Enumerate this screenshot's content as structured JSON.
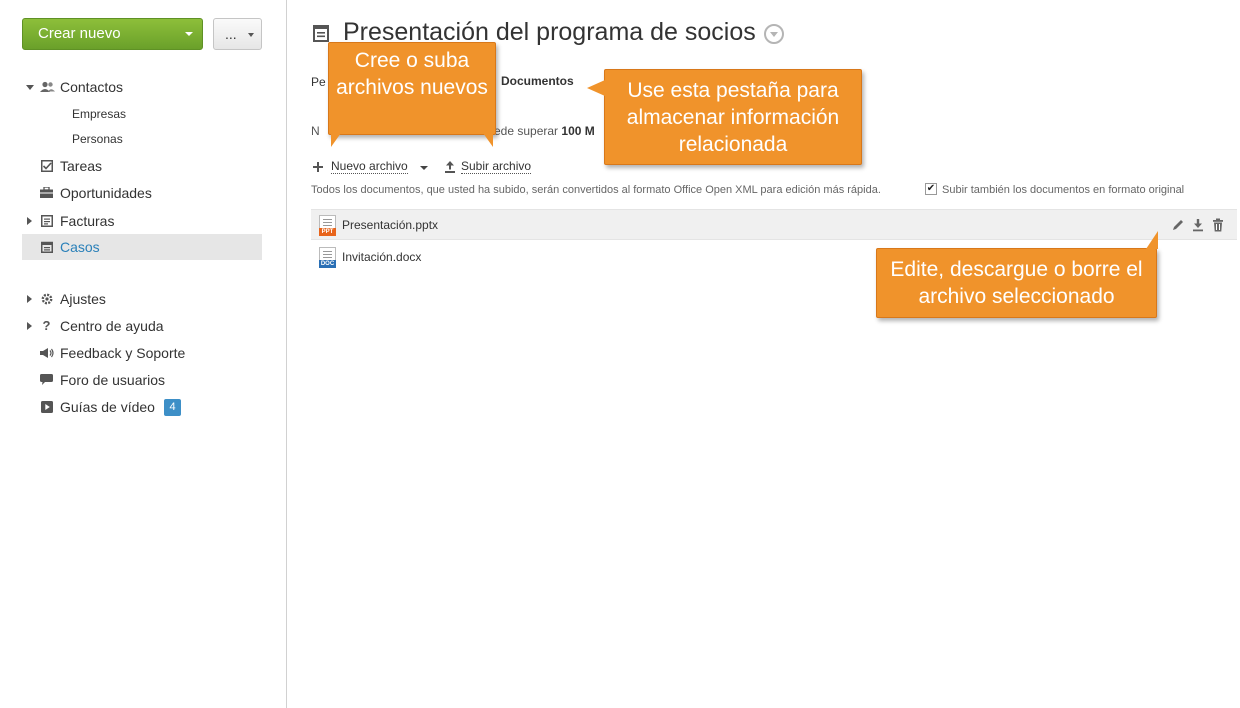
{
  "sidebar": {
    "create_label": "Crear nuevo",
    "more_label": "...",
    "items": [
      {
        "label": "Contactos"
      },
      {
        "label": "Tareas"
      },
      {
        "label": "Oportunidades"
      },
      {
        "label": "Facturas"
      },
      {
        "label": "Casos"
      },
      {
        "label": "Ajustes"
      },
      {
        "label": "Centro de ayuda"
      },
      {
        "label": "Feedback y Soporte"
      },
      {
        "label": "Foro de usuarios"
      },
      {
        "label": "Guías de vídeo"
      }
    ],
    "subitems": [
      {
        "label": "Empresas"
      },
      {
        "label": "Personas"
      }
    ],
    "video_badge": "4"
  },
  "main": {
    "title": "Presentación del programa de socios",
    "tab_partial": "Pe",
    "tab_documents": "Documentos",
    "limit_partial_left": "N",
    "limit_partial_right": "ede superar",
    "limit_value": "100 M",
    "new_file_label": "Nuevo archivo",
    "upload_label": "Subir archivo",
    "conversion_note": "Todos los documentos, que usted ha subido, serán convertidos al formato Office Open XML para edición más rápida.",
    "original_checkbox_label": "Subir también los documentos en formato original",
    "files": [
      {
        "name": "Presentación.pptx",
        "type_tag": "PPT",
        "tag_color": "#e8641b"
      },
      {
        "name": "Invitación.docx",
        "type_tag": "DOC",
        "tag_color": "#2a6fb5"
      }
    ]
  },
  "callouts": {
    "create_upload": "Cree o suba archivos nuevos",
    "tab_usage": "Use esta pestaña para almacenar información relacionada",
    "edit_download_delete": "Edite, descargue o borre el archivo seleccionado"
  },
  "colors": {
    "create_button": "#78ad30",
    "callout": "#f0932b",
    "active_link": "#2a80b9"
  }
}
